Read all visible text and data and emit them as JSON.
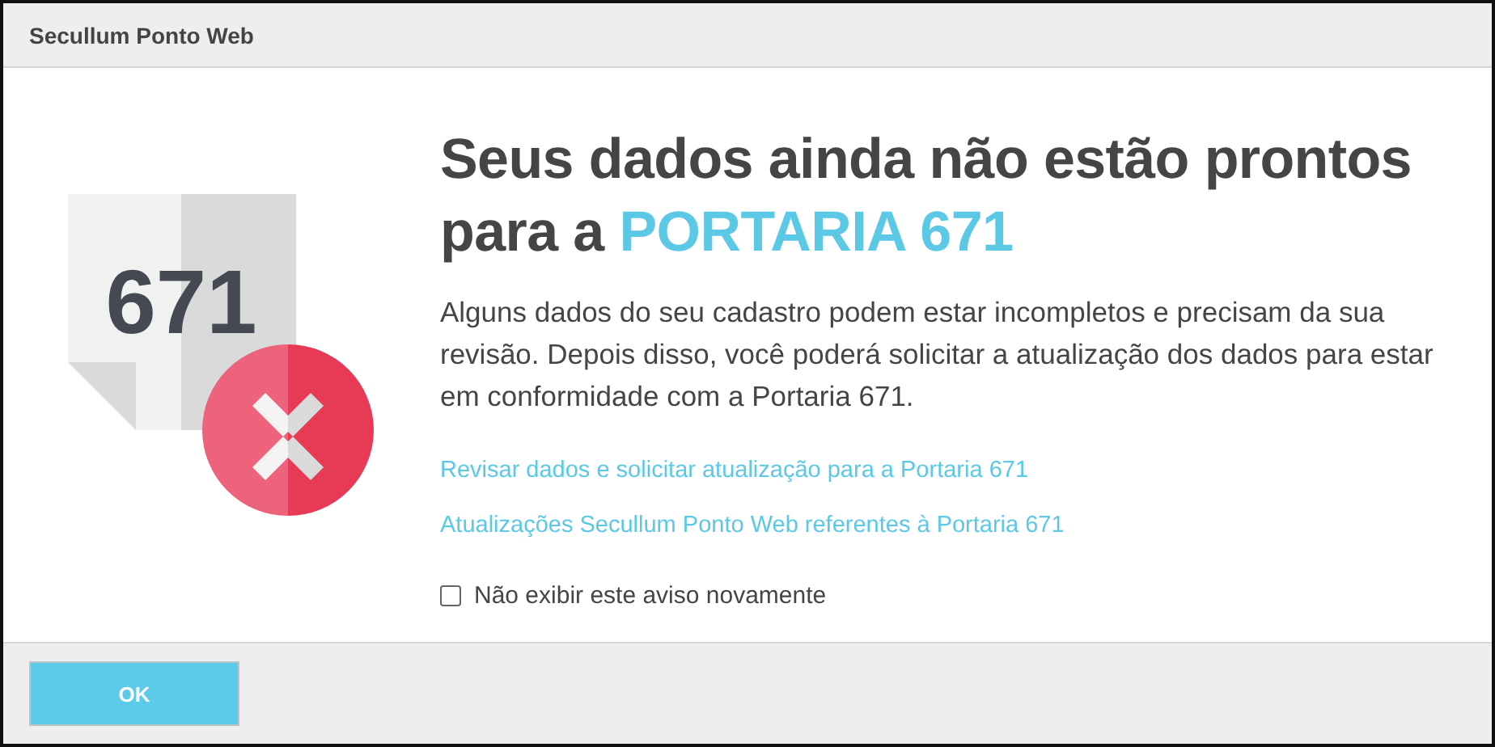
{
  "window": {
    "title": "Secullum Ponto Web"
  },
  "illustration": {
    "number": "671"
  },
  "heading": {
    "text": "Seus dados ainda não estão prontos para a ",
    "highlight": "PORTARIA 671"
  },
  "message": "Alguns dados do seu cadastro podem estar incompletos e precisam da sua revisão. Depois disso, você poderá solicitar a atualização dos dados para estar em conformidade com a Portaria 671.",
  "links": [
    "Revisar dados e solicitar atualização para a Portaria 671",
    "Atualizações Secullum Ponto Web referentes à Portaria 671"
  ],
  "checkbox": {
    "label": "Não exibir este aviso novamente",
    "checked": false
  },
  "buttons": [
    "OK"
  ]
}
